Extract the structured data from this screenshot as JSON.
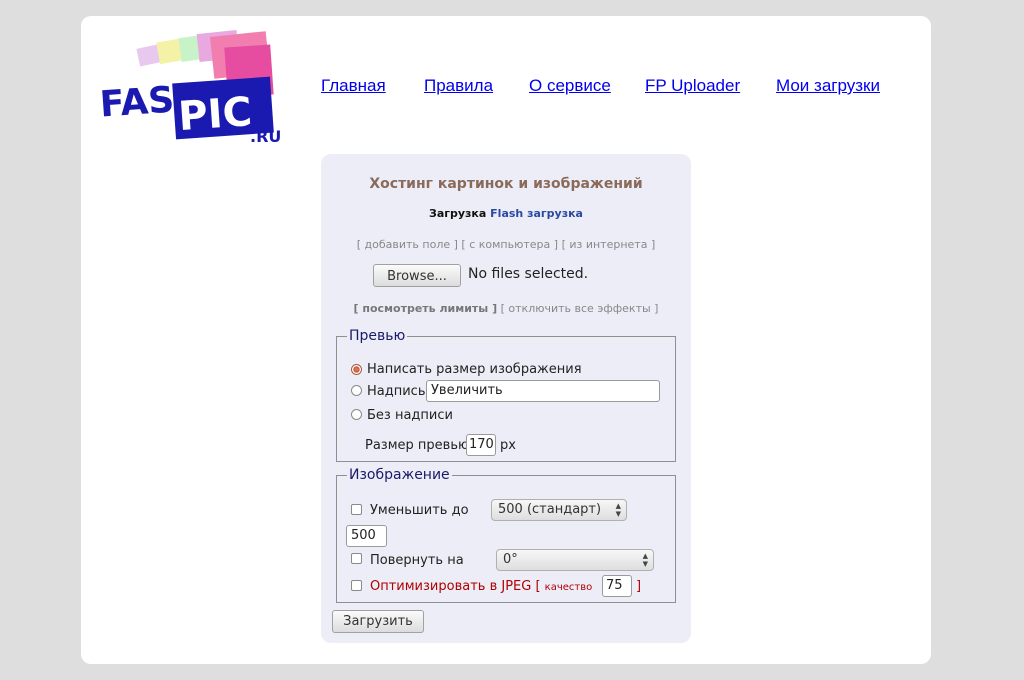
{
  "logo": {
    "text_main": "FAST",
    "text_pic": "PIC",
    "text_domain": ".RU"
  },
  "nav": {
    "items": [
      "Главная",
      "Правила",
      "О сервисе",
      "FP Uploader",
      "Мои загрузки"
    ]
  },
  "upload": {
    "title": "Хостинг картинок и изображений",
    "mode_current": "Загрузка",
    "mode_flash": "Flash загрузка",
    "source_links": {
      "add_field": "[ добавить поле ]",
      "from_computer": "[ с компьютера ]",
      "from_internet": "[ из интернета ]"
    },
    "browse_label": "Browse...",
    "file_status": "No files selected.",
    "extra_links": {
      "limits": "[ посмотреть лимиты ]",
      "disable_effects": "[ отключить все эффекты ]"
    },
    "preview": {
      "legend": "Превью",
      "option_size": "Написать размер изображения",
      "option_caption": "Надпись",
      "caption_value": "Увеличить",
      "option_none": "Без надписи",
      "selected": "option_size",
      "size_label": "Размер превью",
      "size_value": "170",
      "size_unit": "px"
    },
    "image": {
      "legend": "Изображение",
      "resize_label": "Уменьшить до",
      "resize_select": "500 (стандарт)",
      "resize_value": "500",
      "rotate_label": "Повернуть на",
      "rotate_select": "0°",
      "optimize_label": "Оптимизировать в JPEG [",
      "quality_label": "качество",
      "quality_value": "75",
      "optimize_close": "]"
    },
    "submit_label": "Загрузить"
  },
  "colors": {
    "background": "#dedede",
    "panel": "#ededf7",
    "link": "#0000ee",
    "title": "#8a6a5a",
    "accent_red": "#b00000"
  }
}
